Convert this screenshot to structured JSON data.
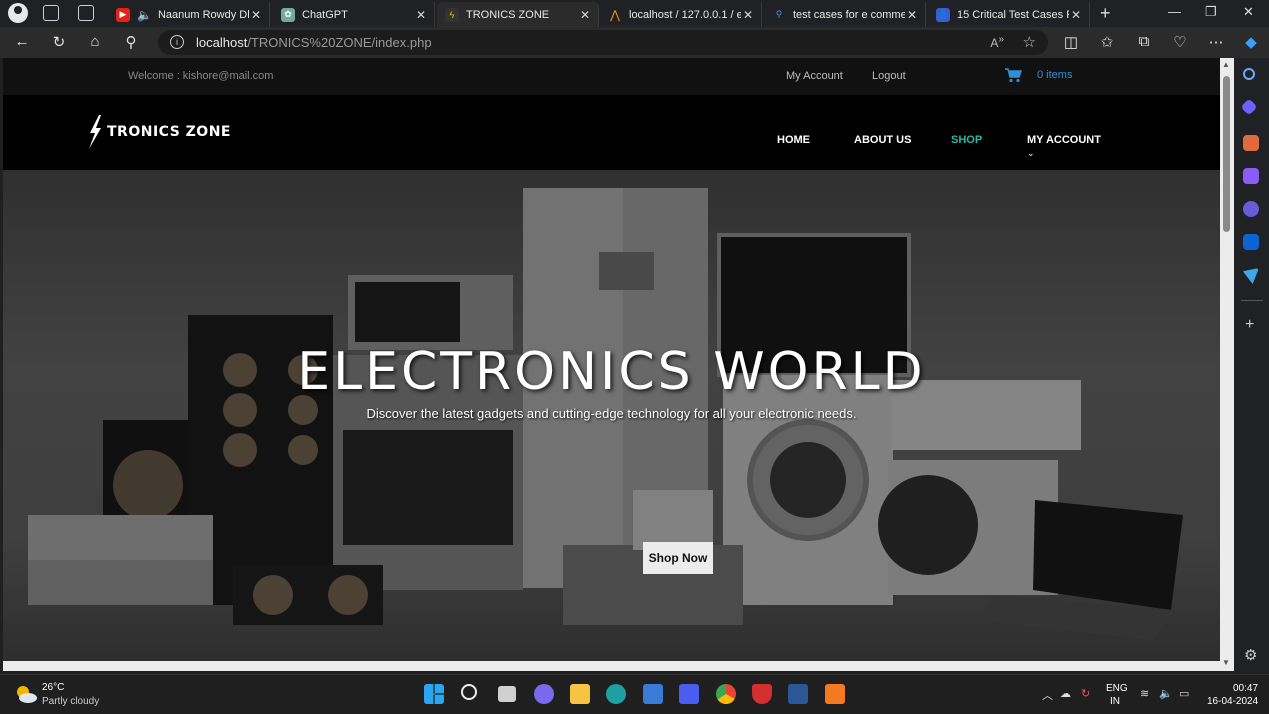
{
  "browser": {
    "tabs": [
      {
        "title": "Naanum Rowdy Dha",
        "favicon": "youtube-icon",
        "color": "#e62117"
      },
      {
        "title": "ChatGPT",
        "favicon": "chatgpt-icon",
        "color": "#75a99c"
      },
      {
        "title": "TRONICS ZONE",
        "favicon": "site-icon",
        "color": "#333333"
      },
      {
        "title": "localhost / 127.0.0.1 / ecc",
        "favicon": "phpmyadmin-icon",
        "color": "#f29111"
      },
      {
        "title": "test cases for e commerc",
        "favicon": "search-icon",
        "color": "#2d6fd6"
      },
      {
        "title": "15 Critical Test Cases For",
        "favicon": "doc-icon",
        "color": "#3b5bdb"
      }
    ],
    "url_host": "localhost",
    "url_path": "/TRONICS%20ZONE/index.php"
  },
  "site": {
    "welcome": "Welcome : kishore@mail.com",
    "my_account_link": "My Account",
    "logout_link": "Logout",
    "cart_count": "0 items",
    "logo_text": "TRONICS ZONE",
    "menu": {
      "home": "HOME",
      "about": "ABOUT US",
      "shop": "SHOP",
      "account": "MY ACCOUNT"
    },
    "accent_color": "#29b7a5"
  },
  "hero": {
    "title": "ELECTRONICS WORLD",
    "subtitle": "Discover the latest gadgets and cutting-edge technology for all your electronic needs.",
    "button": "Shop Now"
  },
  "taskbar": {
    "temperature": "26°C",
    "condition": "Partly cloudy",
    "lang_line1": "ENG",
    "lang_line2": "IN",
    "time": "00:47",
    "date": "16-04-2024"
  }
}
